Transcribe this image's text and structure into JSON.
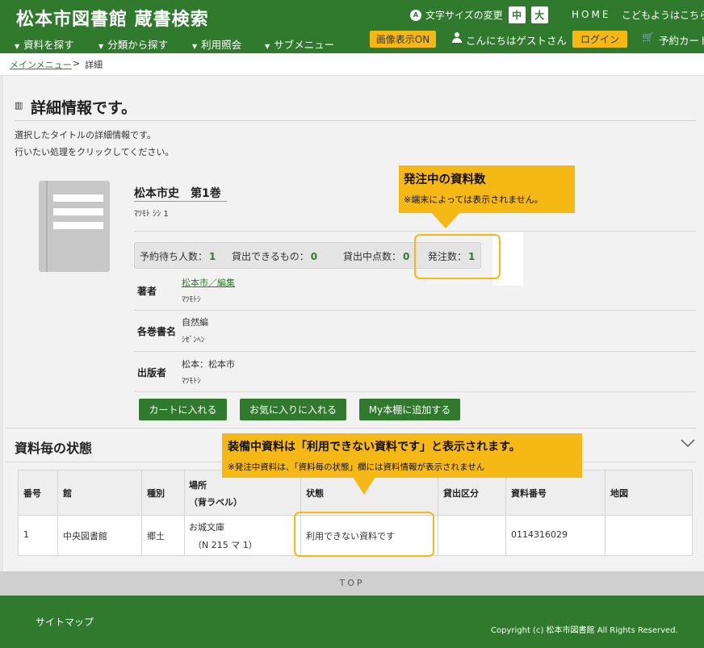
{
  "header": {
    "site_title": "松本市図書館 蔵書検索",
    "font_size_icon": "A",
    "font_size_label": "文字サイズの変更",
    "font_size_medium": "中",
    "font_size_large": "大",
    "home_link": "HOME",
    "kids_link": "こどもようはこちら",
    "nav": [
      "資料を探す",
      "分類から探す",
      "利用照会",
      "サブメニュー"
    ],
    "nav_marker": "▼",
    "image_toggle": "画像表示ON",
    "user_icon": "user-icon",
    "greeting": "こんにちはゲストさん",
    "login": "ログイン",
    "cart_icon": "cart-icon",
    "cart_glyph": "🛒",
    "cart_link": "予約カート"
  },
  "breadcrumb": {
    "home": "メインメニュー",
    "separator": ">",
    "current": "詳細"
  },
  "page": {
    "title_icon": "book-icon",
    "title_glyph": "▥",
    "title": "詳細情報です。",
    "intro_1": "選択したタイトルの詳細情報です。",
    "intro_2": "行いたい処理をクリックしてください。"
  },
  "book": {
    "title": "松本市史　第1巻",
    "title_kana": "ﾏﾂﾓﾄ ｼｼ 1",
    "stats": [
      {
        "label": "予約待ち人数：",
        "value": "1"
      },
      {
        "label": "貸出できるもの：",
        "value": "0"
      },
      {
        "label": "貸出中点数：",
        "value": "0"
      },
      {
        "label": "発注数：",
        "value": "1"
      }
    ],
    "fields": [
      {
        "label": "著者",
        "value": "松本市／編集",
        "kana": "ﾏﾂﾓﾄｼ"
      },
      {
        "label": "各巻書名",
        "value": "自然編",
        "kana": "ｼｾﾞﾝﾍﾝ"
      },
      {
        "label": "出版者",
        "value": "松本：松本市",
        "kana": "ﾏﾂﾓﾄｼ"
      }
    ],
    "buttons": [
      "カートに入れる",
      "お気に入りに入れる",
      "My本棚に追加する"
    ]
  },
  "holdings": {
    "section_title": "資料毎の状態",
    "toggle_icon": "chevron-down-icon",
    "columns": [
      "番号",
      "館",
      "種別",
      "場所",
      "（背ラベル）",
      "状態",
      "貸出区分",
      "資料番号",
      "地図"
    ],
    "rows": [
      {
        "no": "1",
        "library": "中央図書館",
        "type": "郷土",
        "location": "お城文庫",
        "call_label": "（N 215 マ 1）",
        "status": "利用できない資料です",
        "loan_class": "",
        "item_no": "0114316029",
        "map": ""
      }
    ]
  },
  "callouts": {
    "order_title": "発注中の資料数",
    "order_note": "※端末によっては表示されません。",
    "status_title": "装備中資料は「利用できない資料です」と表示されます。",
    "status_note": "※発注中資料は、「資料毎の状態」欄には資料情報が表示されません"
  },
  "footer": {
    "top_link": "TOP",
    "sitemap": "サイトマップ",
    "copyright": "Copyright (c) 松本市図書館 All Rights Reserved."
  },
  "colors": {
    "brand_green": "#2f7a2c",
    "accent_yellow": "#f6b814",
    "background_gray": "#f2f2f2"
  }
}
